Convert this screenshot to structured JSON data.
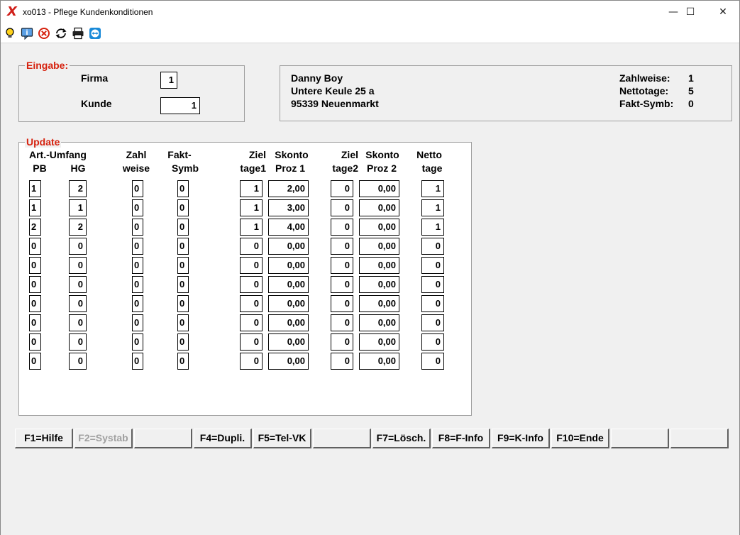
{
  "window": {
    "logo": "X",
    "title": "xo013 - Pflege Kundenkonditionen",
    "minimize": "—",
    "maximize": "☐",
    "close": "✕"
  },
  "toolbar": {
    "icons": [
      "lightbulb-icon",
      "info-icon",
      "cancel-icon",
      "refresh-icon",
      "print-icon",
      "teamviewer-icon"
    ]
  },
  "eingabe": {
    "legend": "Eingabe:",
    "firma_label": "Firma",
    "firma_value": "1",
    "kunde_label": "Kunde",
    "kunde_value": "1"
  },
  "customer": {
    "name": "Danny Boy",
    "street": "Untere Keule 25 a",
    "city": "95339  Neuenmarkt",
    "zahlweise_label": "Zahlweise:",
    "zahlweise_value": "1",
    "nettotage_label": "Nettotage:",
    "nettotage_value": "5",
    "faktsymb_label": "Fakt-Symb:",
    "faktsymb_value": "0"
  },
  "update": {
    "legend": "Update",
    "headers": {
      "art_umfang": "Art.-Umfang",
      "pb": "PB",
      "hg": "HG",
      "zahl": "Zahl",
      "weise": "weise",
      "fakt": "Fakt-",
      "symb": "Symb",
      "ziel1a": "Ziel",
      "ziel1b": "tage1",
      "skonto1a": "Skonto",
      "skonto1b": "Proz 1",
      "ziel2a": "Ziel",
      "ziel2b": "tage2",
      "skonto2a": "Skonto",
      "skonto2b": "Proz 2",
      "nettoa": "Netto",
      "nettob": "tage"
    },
    "rows": [
      {
        "pb": "1",
        "hg": "2",
        "zahlweise": "0",
        "faktsymb": "0",
        "ziel1": "1",
        "skonto1": "2,00",
        "ziel2": "0",
        "skonto2": "0,00",
        "netto": "1"
      },
      {
        "pb": "1",
        "hg": "1",
        "zahlweise": "0",
        "faktsymb": "0",
        "ziel1": "1",
        "skonto1": "3,00",
        "ziel2": "0",
        "skonto2": "0,00",
        "netto": "1"
      },
      {
        "pb": "2",
        "hg": "2",
        "zahlweise": "0",
        "faktsymb": "0",
        "ziel1": "1",
        "skonto1": "4,00",
        "ziel2": "0",
        "skonto2": "0,00",
        "netto": "1"
      },
      {
        "pb": "0",
        "hg": "0",
        "zahlweise": "0",
        "faktsymb": "0",
        "ziel1": "0",
        "skonto1": "0,00",
        "ziel2": "0",
        "skonto2": "0,00",
        "netto": "0"
      },
      {
        "pb": "0",
        "hg": "0",
        "zahlweise": "0",
        "faktsymb": "0",
        "ziel1": "0",
        "skonto1": "0,00",
        "ziel2": "0",
        "skonto2": "0,00",
        "netto": "0"
      },
      {
        "pb": "0",
        "hg": "0",
        "zahlweise": "0",
        "faktsymb": "0",
        "ziel1": "0",
        "skonto1": "0,00",
        "ziel2": "0",
        "skonto2": "0,00",
        "netto": "0"
      },
      {
        "pb": "0",
        "hg": "0",
        "zahlweise": "0",
        "faktsymb": "0",
        "ziel1": "0",
        "skonto1": "0,00",
        "ziel2": "0",
        "skonto2": "0,00",
        "netto": "0"
      },
      {
        "pb": "0",
        "hg": "0",
        "zahlweise": "0",
        "faktsymb": "0",
        "ziel1": "0",
        "skonto1": "0,00",
        "ziel2": "0",
        "skonto2": "0,00",
        "netto": "0"
      },
      {
        "pb": "0",
        "hg": "0",
        "zahlweise": "0",
        "faktsymb": "0",
        "ziel1": "0",
        "skonto1": "0,00",
        "ziel2": "0",
        "skonto2": "0,00",
        "netto": "0"
      },
      {
        "pb": "0",
        "hg": "0",
        "zahlweise": "0",
        "faktsymb": "0",
        "ziel1": "0",
        "skonto1": "0,00",
        "ziel2": "0",
        "skonto2": "0,00",
        "netto": "0"
      }
    ]
  },
  "fkeys": [
    {
      "label": "F1=Hilfe",
      "enabled": true
    },
    {
      "label": "F2=Systab",
      "enabled": false
    },
    {
      "label": "",
      "enabled": false
    },
    {
      "label": "F4=Dupli.",
      "enabled": true
    },
    {
      "label": "F5=Tel-VK",
      "enabled": true
    },
    {
      "label": "",
      "enabled": false
    },
    {
      "label": "F7=Lösch.",
      "enabled": true
    },
    {
      "label": "F8=F-Info",
      "enabled": true
    },
    {
      "label": "F9=K-Info",
      "enabled": true
    },
    {
      "label": "F10=Ende",
      "enabled": true
    },
    {
      "label": "",
      "enabled": false
    },
    {
      "label": "",
      "enabled": false
    }
  ],
  "colors": {
    "accent_red": "#d6220f",
    "selection_blue": "#1e6ac8"
  }
}
